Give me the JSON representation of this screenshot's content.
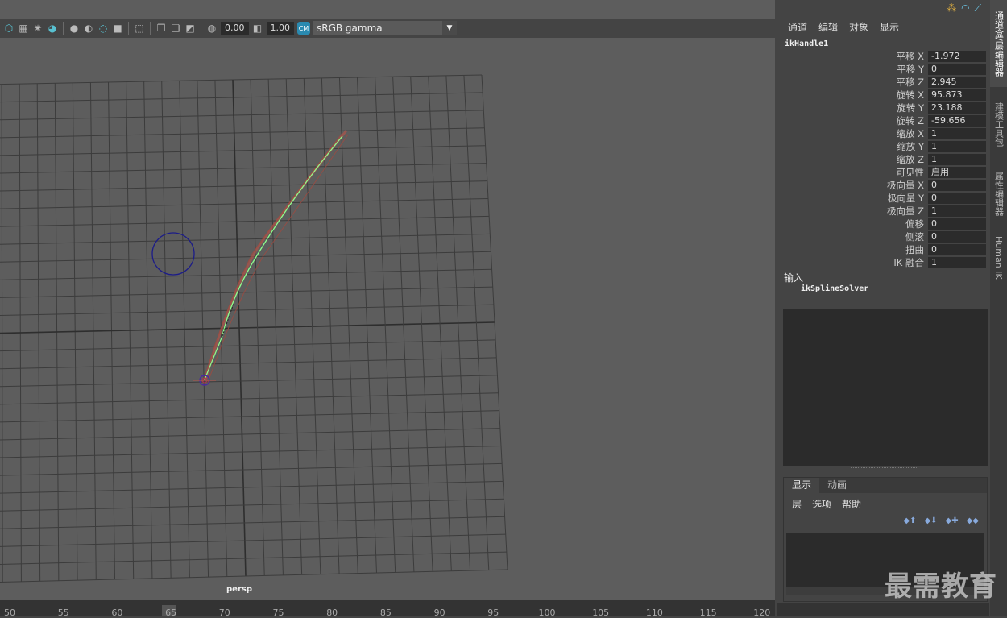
{
  "viewport": {
    "toolbar": {
      "exposure": "0.00",
      "gamma": "1.00",
      "colorspace": "sRGB gamma"
    },
    "camera_label": "persp"
  },
  "channel_box": {
    "menu": [
      "通道",
      "编辑",
      "对象",
      "显示"
    ],
    "node": "ikHandle1",
    "attributes": [
      {
        "label": "平移 X",
        "value": "-1.972"
      },
      {
        "label": "平移 Y",
        "value": "0"
      },
      {
        "label": "平移 Z",
        "value": "2.945"
      },
      {
        "label": "旋转 X",
        "value": "95.873"
      },
      {
        "label": "旋转 Y",
        "value": "23.188"
      },
      {
        "label": "旋转 Z",
        "value": "-59.656"
      },
      {
        "label": "缩放 X",
        "value": "1"
      },
      {
        "label": "缩放 Y",
        "value": "1"
      },
      {
        "label": "缩放 Z",
        "value": "1"
      },
      {
        "label": "可见性",
        "value": "启用"
      },
      {
        "label": "极向量 X",
        "value": "0"
      },
      {
        "label": "极向量 Y",
        "value": "0"
      },
      {
        "label": "极向量 Z",
        "value": "1"
      },
      {
        "label": "偏移",
        "value": "0"
      },
      {
        "label": "侧滚",
        "value": "0"
      },
      {
        "label": "扭曲",
        "value": "0"
      },
      {
        "label": "IK 融合",
        "value": "1"
      }
    ],
    "inputs_title": "输入",
    "input_node": "ikSplineSolver"
  },
  "layer_editor": {
    "tabs": [
      "显示",
      "动画"
    ],
    "menu": [
      "层",
      "选项",
      "帮助"
    ]
  },
  "side_tabs": [
    "通道盒/层编辑器",
    "建模工具包",
    "属性编辑器",
    "Human IK"
  ],
  "timeline": {
    "ticks": [
      "50",
      "55",
      "60",
      "65",
      "70",
      "75",
      "80",
      "85",
      "90",
      "95",
      "100",
      "105",
      "110",
      "115",
      "120"
    ]
  },
  "watermark": "最需教育"
}
